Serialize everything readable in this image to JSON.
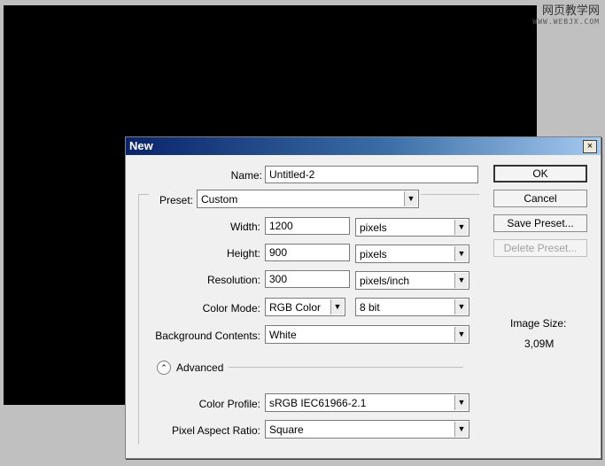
{
  "watermark": {
    "line1": "网页教学网",
    "line2": "WWW.WEBJX.COM"
  },
  "dialog": {
    "title": "New",
    "close_glyph": "×",
    "name": {
      "label": "Name:",
      "value": "Untitled-2"
    },
    "preset": {
      "label": "Preset:",
      "value": "Custom"
    },
    "width": {
      "label": "Width:",
      "value": "1200",
      "unit": "pixels"
    },
    "height": {
      "label": "Height:",
      "value": "900",
      "unit": "pixels"
    },
    "resolution": {
      "label": "Resolution:",
      "value": "300",
      "unit": "pixels/inch"
    },
    "color_mode": {
      "label": "Color Mode:",
      "value": "RGB Color",
      "depth": "8 bit"
    },
    "background": {
      "label": "Background Contents:",
      "value": "White"
    },
    "advanced": {
      "label": "Advanced",
      "icon": "collapse-chevron-icon"
    },
    "color_profile": {
      "label": "Color Profile:",
      "value": "sRGB IEC61966-2.1"
    },
    "pixel_aspect": {
      "label": "Pixel Aspect Ratio:",
      "value": "Square"
    },
    "buttons": {
      "ok": "OK",
      "cancel": "Cancel",
      "save_preset": "Save Preset...",
      "delete_preset": "Delete Preset..."
    },
    "image_size": {
      "label": "Image Size:",
      "value": "3,09M"
    },
    "dropdown_glyph": "▼",
    "advanced_glyph": "⌃"
  }
}
